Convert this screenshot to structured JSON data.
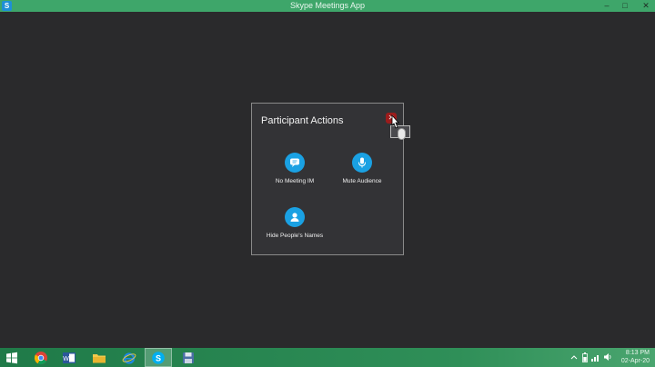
{
  "window": {
    "title": "Skype Meetings App",
    "controls": {
      "minimize": "–",
      "maximize": "□",
      "close": "✕"
    }
  },
  "dialog": {
    "title": "Participant Actions",
    "close_icon": "close-icon",
    "actions": [
      {
        "label": "No Meeting IM",
        "icon": "chat-bubble-icon"
      },
      {
        "label": "Mute Audience",
        "icon": "microphone-icon"
      },
      {
        "label": "Hide People's Names",
        "icon": "person-icon"
      }
    ]
  },
  "taskbar": {
    "apps": [
      "chrome-icon",
      "word-icon",
      "file-explorer-icon",
      "internet-explorer-icon",
      "skype-icon",
      "save-icon"
    ],
    "active_app": "skype-icon",
    "clock": {
      "time": "8:13 PM",
      "date": "02-Apr-20"
    }
  },
  "colors": {
    "titlebar": "#3ea66a",
    "accent": "#1aa1e3",
    "close": "#9c1c1c",
    "background": "#2a2a2c"
  }
}
